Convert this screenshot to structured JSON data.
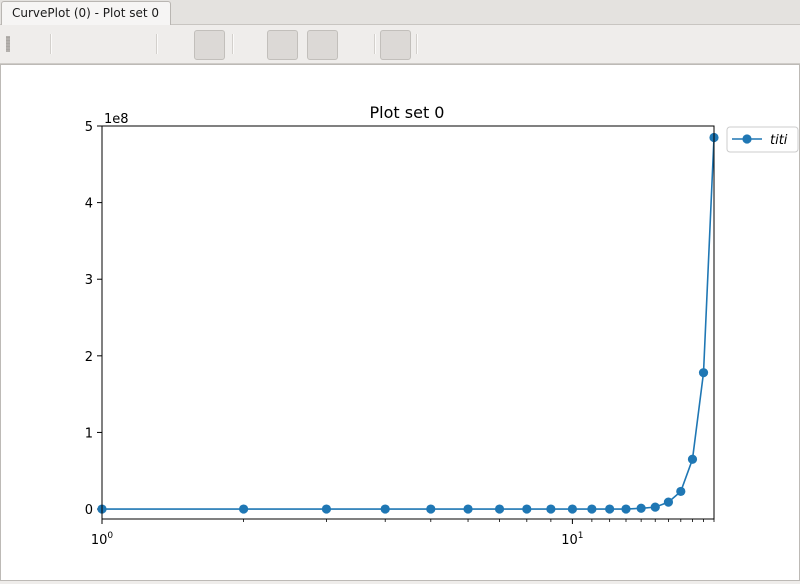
{
  "tab": {
    "label": "CurvePlot (0) - Plot set 0"
  },
  "chart_data": {
    "type": "line",
    "title": "Plot set 0",
    "xscale": "log",
    "xlim": [
      1,
      20
    ],
    "ylim": [
      -13000000.0,
      500000000.0
    ],
    "x_tick_labels": [
      {
        "x": 1,
        "base": "10",
        "exp": "0"
      },
      {
        "x": 10,
        "base": "10",
        "exp": "1"
      }
    ],
    "y_ticks": [
      0,
      100000000.0,
      200000000.0,
      300000000.0,
      400000000.0,
      500000000.0
    ],
    "y_tick_labels": [
      "0",
      "1",
      "2",
      "3",
      "4",
      "5"
    ],
    "y_offset_label": "1e8",
    "legend_position": "upper-right-outside",
    "series": [
      {
        "name": "titi",
        "color": "#1f77b4",
        "marker": "circle",
        "x": [
          1,
          2,
          3,
          4,
          5,
          6,
          7,
          8,
          9,
          10,
          11,
          12,
          13,
          14,
          15,
          16,
          17,
          18,
          19,
          20
        ],
        "y": [
          0,
          0,
          0,
          0,
          0,
          0,
          0,
          0,
          0,
          0,
          0,
          0,
          0,
          1000000.0,
          2500000.0,
          9000000.0,
          23000000.0,
          65000000.0,
          178000000.0,
          485000000.0
        ]
      }
    ]
  }
}
